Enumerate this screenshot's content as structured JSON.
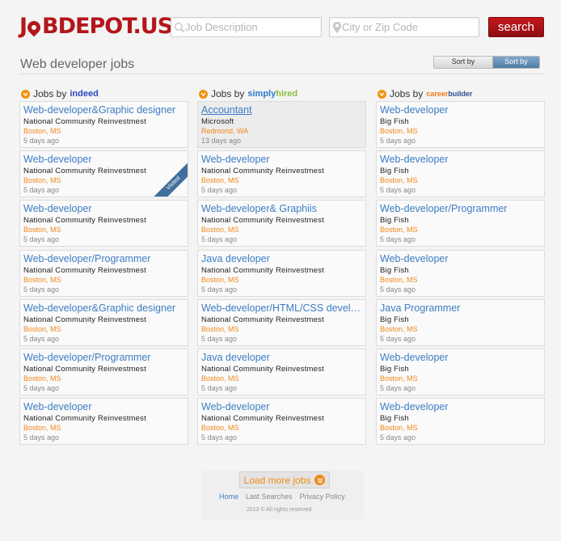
{
  "logo": {
    "part1": "J",
    "part2": "BDEPOT.US"
  },
  "search": {
    "job_placeholder": "Job Description",
    "location_placeholder": "City or Zip Code",
    "button_label": "search"
  },
  "page_title": "Web developer jobs",
  "sort": {
    "relevance_label": "Sort by relevance",
    "date_label": "Sort by date",
    "active": "date"
  },
  "columns": [
    {
      "prefix": "Jobs by",
      "brand": "indeed",
      "jobs": [
        {
          "title": "Web-developer&Graphic designer",
          "company": "National Community Reinvestmest",
          "location": "Boston, MS",
          "age": "5 days ago"
        },
        {
          "title": "Web-developer",
          "company": "National Community Reinvestmest",
          "location": "Boston, MS",
          "age": "5 days ago",
          "badge": "Visited"
        },
        {
          "title": "Web-developer",
          "company": "National Community Reinvestmest",
          "location": "Boston, MS",
          "age": "5 days ago"
        },
        {
          "title": "Web-developer/Programmer",
          "company": "National Community Reinvestmest",
          "location": "Boston, MS",
          "age": "5 days ago"
        },
        {
          "title": "Web-developer&Graphic designer",
          "company": "National Community Reinvestmest",
          "location": "Boston, MS",
          "age": "5 days ago"
        },
        {
          "title": "Web-developer/Programmer",
          "company": "National Community Reinvestmest",
          "location": "Boston, MS",
          "age": "5 days ago"
        },
        {
          "title": "Web-developer",
          "company": "National Community Reinvestmest",
          "location": "Boston, MS",
          "age": "5 days ago"
        }
      ]
    },
    {
      "prefix": "Jobs by",
      "brand_part1": "simply",
      "brand_part2": "hired",
      "jobs": [
        {
          "title": "Accountant",
          "company": "Microsoft",
          "location": "Redmond, WA",
          "age": "13 days ago"
        },
        {
          "title": "Web-developer",
          "company": "National Community Reinvestmest",
          "location": "Boston, MS",
          "age": "5 days ago"
        },
        {
          "title": "Web-developer& Graphiis",
          "company": "National Community Reinvestmest",
          "location": "Boston, MS",
          "age": "5 days ago"
        },
        {
          "title": "Java developer",
          "company": "National Community Reinvestmest",
          "location": "Boston, MS",
          "age": "5 days ago"
        },
        {
          "title": "Web-developer/HTML/CSS develo...",
          "company": "National Community Reinvestmest",
          "location": "Boston, MS",
          "age": "5 days ago"
        },
        {
          "title": "Java developer",
          "company": "National Community Reinvestmest",
          "location": "Boston, MS",
          "age": "5 days ago"
        },
        {
          "title": "Web-developer",
          "company": "National Community Reinvestmest",
          "location": "Boston, MS",
          "age": "5 days ago"
        }
      ]
    },
    {
      "prefix": "Jobs by",
      "brand_part1": "career",
      "brand_part2": "builder",
      "jobs": [
        {
          "title": "Web-developer",
          "company": "Big Fish",
          "location": "Boston, MS",
          "age": "5 days ago"
        },
        {
          "title": "Web-developer",
          "company": "Big Fish",
          "location": "Boston, MS",
          "age": "5 days ago"
        },
        {
          "title": "Web-developer/Programmer",
          "company": "Big Fish",
          "location": "Boston, MS",
          "age": "5 days ago"
        },
        {
          "title": "Web-developer",
          "company": "Big Fish",
          "location": "Boston, MS",
          "age": "5 days ago"
        },
        {
          "title": "Java Programmer",
          "company": "Big Fish",
          "location": "Boston, MS",
          "age": "5 days ago"
        },
        {
          "title": "Web-developer",
          "company": "Big Fish",
          "location": "Boston, MS",
          "age": "5 days ago"
        },
        {
          "title": "Web-developer",
          "company": "Big Fish",
          "location": "Boston, MS",
          "age": "5 days ago"
        }
      ]
    }
  ],
  "load_more_label": "Load more jobs",
  "footer": {
    "links": [
      "Home",
      "Last Searches",
      "Privacy Policy"
    ],
    "copyright": "2013 © All rights reserved"
  },
  "colors": {
    "brand_red": "#b3161b",
    "link_blue": "#3d7dc4",
    "location_orange": "#f0881a",
    "sort_active": "#4f7ea6"
  }
}
